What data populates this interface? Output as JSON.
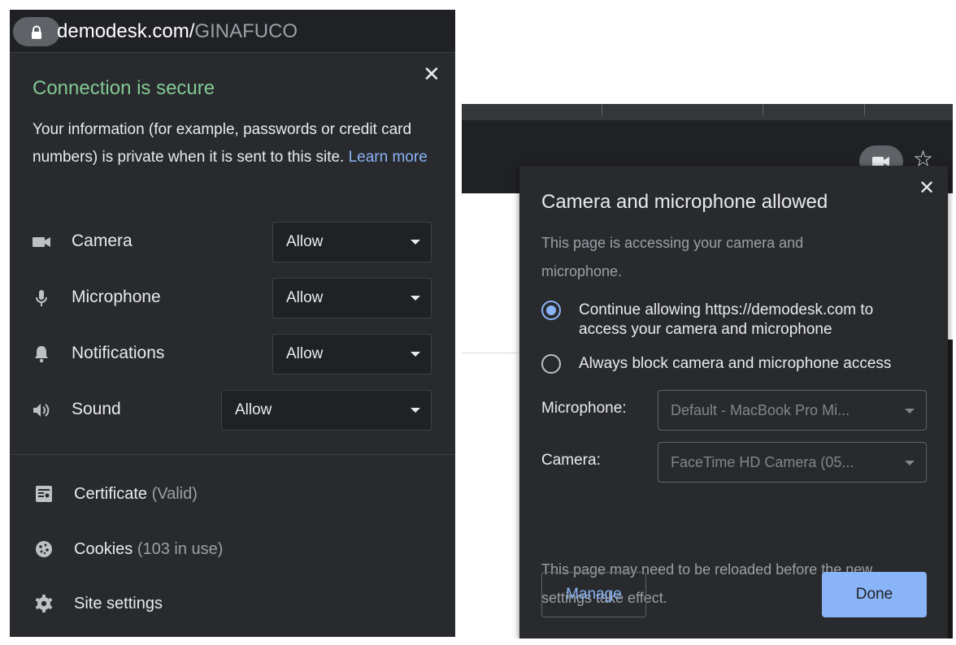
{
  "site_info_popup": {
    "url_domain": "demodesk.com/",
    "url_path": "GINAFUCO",
    "icons": {
      "lock": "lock-icon",
      "close": "close-icon"
    },
    "close_glyph": "✕",
    "title": "Connection is secure",
    "description": "Your information (for example, passwords or credit card numbers) is private when it is sent to this site.",
    "learn_more": "Learn more",
    "permissions": [
      {
        "label": "Camera",
        "value": "Allow",
        "icon": "camera-icon"
      },
      {
        "label": "Microphone",
        "value": "Allow",
        "icon": "microphone-icon"
      },
      {
        "label": "Notifications",
        "value": "Allow",
        "icon": "bell-icon"
      },
      {
        "label": "Sound",
        "value": "Allow",
        "icon": "speaker-icon"
      }
    ],
    "links": [
      {
        "label": "Certificate",
        "sub": "(Valid)",
        "icon": "certificate-icon"
      },
      {
        "label": "Cookies",
        "sub": "(103 in use)",
        "icon": "cookie-icon"
      },
      {
        "label": "Site settings",
        "sub": "",
        "icon": "gear-icon"
      }
    ]
  },
  "camera_mic_dialog": {
    "toolbar_icons": {
      "camera": "video-camera-icon",
      "bookmark": "star-icon"
    },
    "star_glyph": "☆",
    "close_glyph": "✕",
    "title": "Camera and microphone allowed",
    "description": "This page is accessing your camera and microphone.",
    "options": [
      {
        "label_line1": "Continue allowing https://demodesk.com to",
        "label_line2": "access your camera and microphone",
        "selected": true
      },
      {
        "label_line1": "Always block camera and microphone access",
        "label_line2": "",
        "selected": false
      }
    ],
    "microphone_label": "Microphone:",
    "microphone_value": "Default - MacBook Pro Mi...",
    "camera_label": "Camera:",
    "camera_value": "FaceTime HD Camera (05...",
    "reload_note": "This page may need to be reloaded before the new settings take effect.",
    "manage_label": "Manage",
    "done_label": "Done"
  },
  "colors": {
    "panel_bg": "#292a2d",
    "secure_green": "#81c995",
    "link_blue": "#8ab4f8",
    "text_primary": "#e8eaed",
    "text_secondary": "#9aa0a6"
  }
}
